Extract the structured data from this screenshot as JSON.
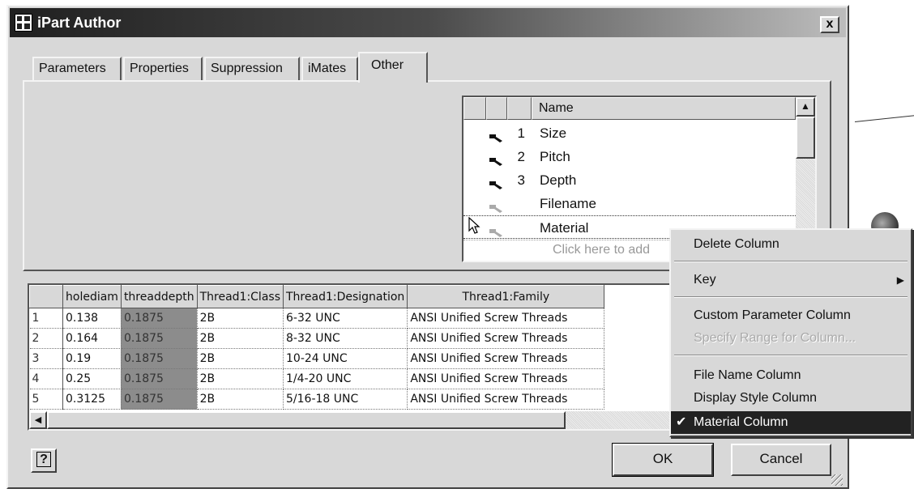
{
  "window": {
    "title": "iPart Author",
    "close_label": "x"
  },
  "tabs": [
    "Parameters",
    "Properties",
    "Suppression",
    "iMates",
    "Other"
  ],
  "active_tab": "Other",
  "param_list": {
    "header": "Name",
    "rows": [
      {
        "num": "1",
        "name": "Size",
        "key": "dark"
      },
      {
        "num": "2",
        "name": "Pitch",
        "key": "dark"
      },
      {
        "num": "3",
        "name": "Depth",
        "key": "dark"
      },
      {
        "num": "",
        "name": "Filename",
        "key": "light"
      },
      {
        "num": "",
        "name": "Material",
        "key": "light"
      }
    ],
    "add_text": "Click here to add"
  },
  "grid": {
    "columns": [
      "holediam",
      "threaddepth",
      "Thread1:Class",
      "Thread1:Designation",
      "Thread1:Family"
    ],
    "rows": [
      [
        "1",
        "0.138",
        "0.1875",
        "2B",
        "6-32 UNC",
        "ANSI Unified Screw Threads"
      ],
      [
        "2",
        "0.164",
        "0.1875",
        "2B",
        "8-32 UNC",
        "ANSI Unified Screw Threads"
      ],
      [
        "3",
        "0.19",
        "0.1875",
        "2B",
        "10-24 UNC",
        "ANSI Unified Screw Threads"
      ],
      [
        "4",
        "0.25",
        "0.1875",
        "2B",
        "1/4-20 UNC",
        "ANSI Unified Screw Threads"
      ],
      [
        "5",
        "0.3125",
        "0.1875",
        "2B",
        "5/16-18 UNC",
        "ANSI Unified Screw Threads"
      ]
    ]
  },
  "context_menu": {
    "delete": "Delete Column",
    "key": "Key",
    "custom_param": "Custom Parameter Column",
    "specify_range": "Specify Range for Column...",
    "file_name": "File Name Column",
    "display_style": "Display Style Column",
    "material": "Material Column"
  },
  "buttons": {
    "ok": "OK",
    "cancel": "Cancel",
    "help": "?"
  },
  "icons": {
    "key": "key-icon",
    "help": "help-icon",
    "cursor": "cursor-arrow-icon"
  }
}
